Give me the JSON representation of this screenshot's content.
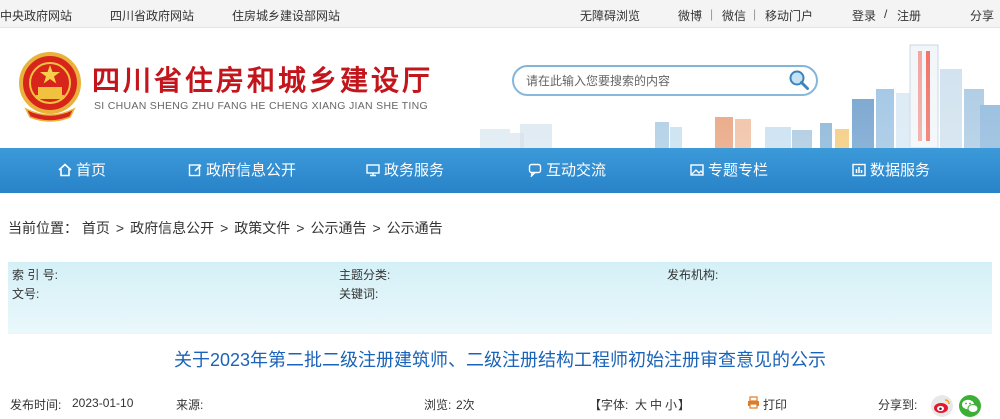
{
  "topbar": {
    "links": [
      "中央政府网站",
      "四川省政府网站",
      "住房城乡建设部网站"
    ],
    "accessibility": "无障碍浏览",
    "social": [
      "微博",
      "微信",
      "移动门户"
    ],
    "login": "登录",
    "slash": "/",
    "register": "注册",
    "share": "分享"
  },
  "header": {
    "title": "四川省住房和城乡建设厅",
    "subtitle": "SI CHUAN SHENG ZHU FANG HE CHENG XIANG JIAN SHE TING",
    "search_placeholder": "请在此输入您要搜索的内容"
  },
  "nav": {
    "items": [
      "首页",
      "政府信息公开",
      "政务服务",
      "互动交流",
      "专题专栏",
      "数据服务"
    ]
  },
  "breadcrumb": {
    "label": "当前位置：",
    "items": [
      "首页",
      "政府信息公开",
      "政策文件",
      "公示通告",
      "公示通告"
    ]
  },
  "info": {
    "index_label": "索 引 号:",
    "category_label": "主题分类:",
    "publisher_label": "发布机构:",
    "docno_label": "文号:",
    "keywords_label": "关键词:"
  },
  "article": {
    "title": "关于2023年第二批二级注册建筑师、二级注册结构工程师初始注册审查意见的公示",
    "publish_label": "发布时间:",
    "publish_date": "2023-01-10",
    "source_label": "来源:",
    "views_label": "浏览:",
    "views_value": "2次",
    "font_label": "【字体:",
    "font_sizes": [
      "大",
      "中",
      "小"
    ],
    "font_close": "】",
    "print_label": "打印",
    "share_label": "分享到:"
  },
  "colors": {
    "title_red": "#c2161c",
    "nav_blue": "#2f8ed1",
    "link_blue": "#1a63b8",
    "info_bg": "#d9f2f8"
  }
}
